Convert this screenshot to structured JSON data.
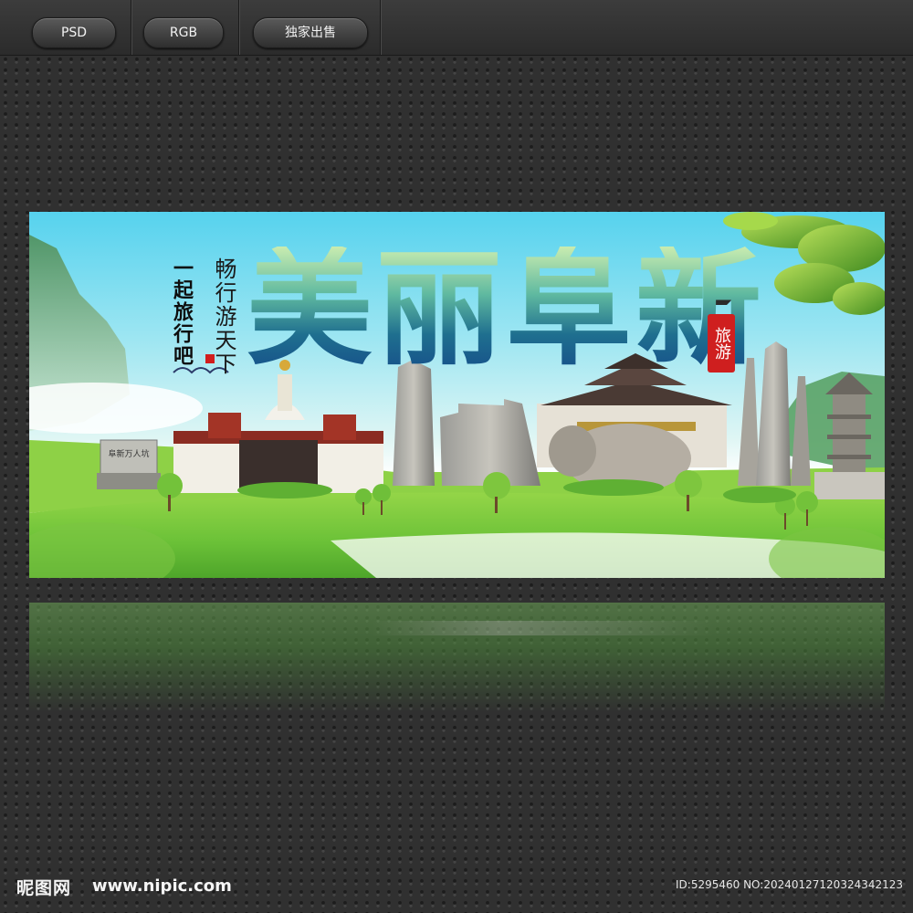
{
  "toolbar": {
    "buttons": [
      {
        "label": "PSD"
      },
      {
        "label": "RGB"
      },
      {
        "label": "独家出售"
      }
    ]
  },
  "poster": {
    "slogan_vertical": "畅行游天下",
    "together_vertical": "一起旅行吧",
    "main_title": "美丽阜新",
    "seal_text": "旅游",
    "monument_plaque": "阜新万人坑",
    "colors": {
      "sky_top": "#56d2ee",
      "grass": "#7fcf3c",
      "title_gradient_top": "#c9ecb0",
      "title_gradient_bottom": "#16508a",
      "seal_red": "#cf1f1f"
    }
  },
  "footer": {
    "logo": "昵图网",
    "url": "www.nipic.com",
    "id_text": "ID:5295460 NO:20240127120324342123"
  }
}
